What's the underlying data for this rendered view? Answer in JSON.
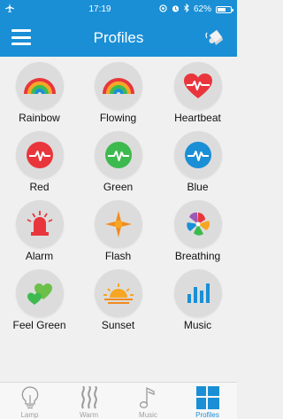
{
  "status": {
    "time": "17:19",
    "battery": "62%",
    "battery_level": 0.62
  },
  "header": {
    "title": "Profiles"
  },
  "profiles": [
    {
      "label": "Rainbow",
      "icon": "rainbow-icon"
    },
    {
      "label": "Flowing",
      "icon": "rainbow-icon"
    },
    {
      "label": "Heartbeat",
      "icon": "heartbeat-icon"
    },
    {
      "label": "Red",
      "icon": "pulse-icon"
    },
    {
      "label": "Green",
      "icon": "pulse-icon"
    },
    {
      "label": "Blue",
      "icon": "pulse-icon"
    },
    {
      "label": "Alarm",
      "icon": "alarm-light-icon"
    },
    {
      "label": "Flash",
      "icon": "flash-star-icon"
    },
    {
      "label": "Breathing",
      "icon": "pinwheel-icon"
    },
    {
      "label": "Feel Green",
      "icon": "green-hearts-icon"
    },
    {
      "label": "Sunset",
      "icon": "sunset-icon"
    },
    {
      "label": "Music",
      "icon": "equalizer-icon"
    }
  ],
  "tabs": [
    {
      "label": "Lamp",
      "icon": "bulb-icon"
    },
    {
      "label": "Warm",
      "icon": "warm-waves-icon"
    },
    {
      "label": "Music",
      "icon": "music-note-icon"
    },
    {
      "label": "Profiles",
      "icon": "grid-icon",
      "active": true
    }
  ],
  "colors": {
    "accent": "#1a8fd6",
    "red": "#e8363c",
    "green": "#3dba4e",
    "blue": "#1a8fd6",
    "orange": "#f28a1e"
  }
}
